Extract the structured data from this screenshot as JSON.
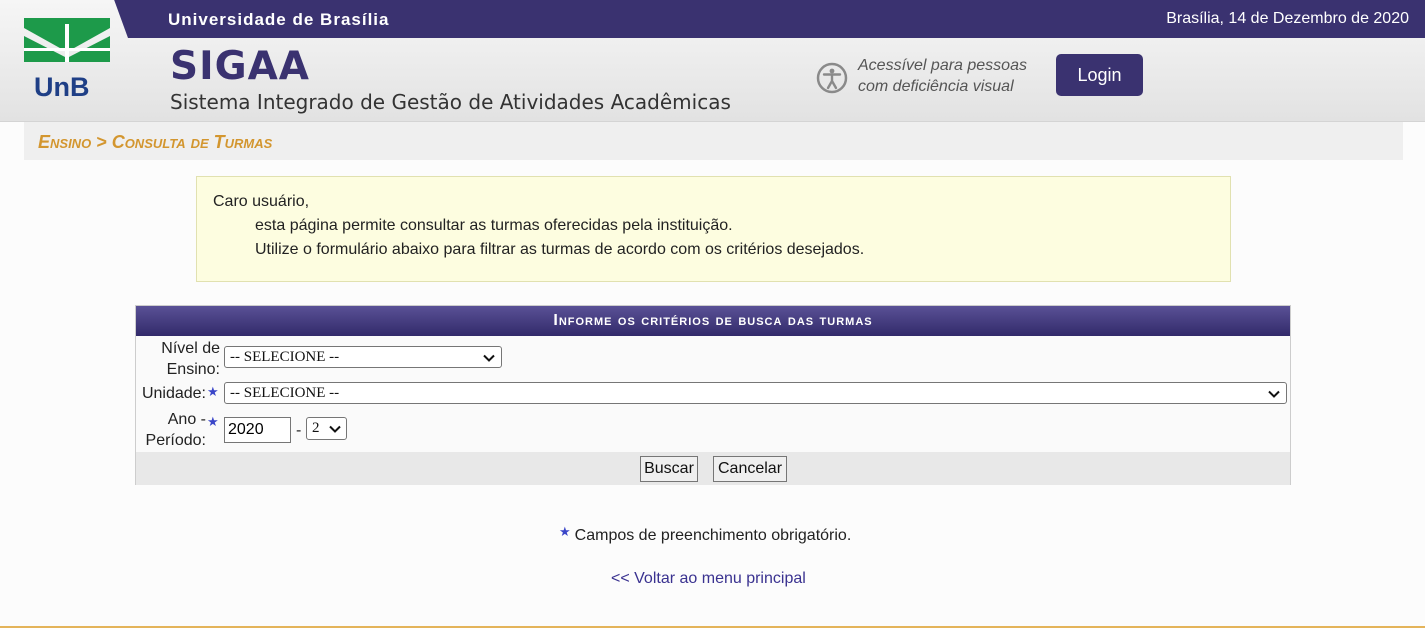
{
  "header": {
    "university": "Universidade de Brasília",
    "date": "Brasília, 14 de Dezembro de 2020",
    "logo_text": "UnB",
    "app_title": "SIGAA",
    "app_subtitle": "Sistema Integrado de Gestão de Atividades Acadêmicas",
    "accessibility_line1": "Acessível para pessoas",
    "accessibility_line2": "com deficiência visual",
    "login_label": "Login"
  },
  "breadcrumb": "Ensino > Consulta de Turmas",
  "info": {
    "greeting": "Caro usuário,",
    "line1": "esta página permite consultar as turmas oferecidas pela instituição.",
    "line2": "Utilize o formulário abaixo para filtrar as turmas de acordo com os critérios desejados."
  },
  "form": {
    "caption": "Informe os critérios de busca das turmas",
    "nivel_label_1": "Nível de",
    "nivel_label_2": "Ensino:",
    "nivel_value": "-- SELECIONE --",
    "unidade_label": "Unidade:",
    "unidade_value": "-- SELECIONE --",
    "ano_label_1": "Ano -",
    "ano_label_2": "Período:",
    "ano_value": "2020",
    "separator": "-",
    "periodo_value": "2",
    "buscar_label": "Buscar",
    "cancelar_label": "Cancelar"
  },
  "required_note": "Campos de preenchimento obrigatório.",
  "back_link": "<< Voltar ao menu principal",
  "colors": {
    "primary": "#3a3270",
    "breadcrumb": "#d3962f",
    "info_bg": "#fdfde0",
    "required_star": "#3a45c8"
  }
}
